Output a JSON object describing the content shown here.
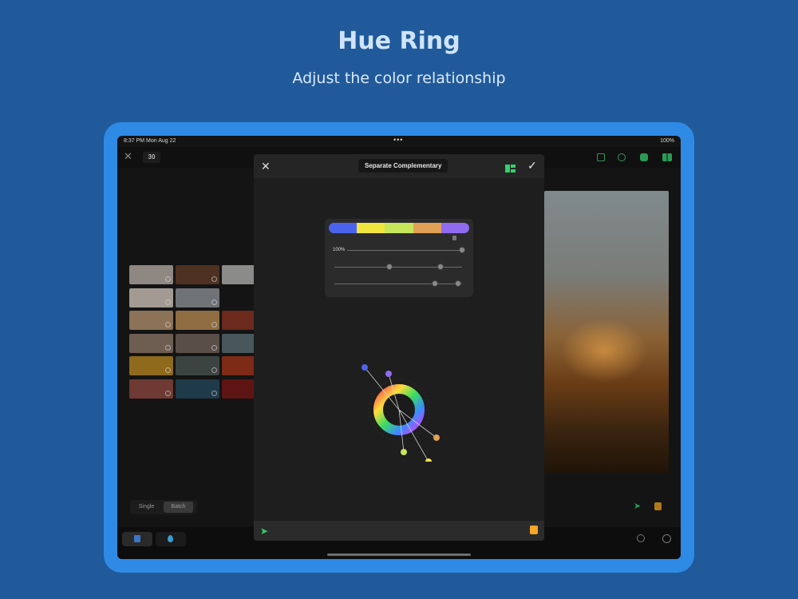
{
  "promo": {
    "title": "Hue Ring",
    "subtitle": "Adjust the color relationship"
  },
  "status_bar": {
    "time": "8:37 PM  Mon Aug 22",
    "center": "•••",
    "battery": "100%"
  },
  "toolbar": {
    "count": "30"
  },
  "bottom_toggle": {
    "single": "Single",
    "batch": "Batch",
    "active": "Batch"
  },
  "modal": {
    "title": "Separate Complementary",
    "palette": [
      "#4b63ec",
      "#f1e63d",
      "#c5e55a",
      "#e0a055",
      "#8f6bf0"
    ],
    "percent_label": "100%",
    "sliders": [
      {
        "values": [
          1.0
        ]
      },
      {
        "values": [
          0.43,
          0.83
        ]
      },
      {
        "values": [
          0.79,
          0.97
        ]
      }
    ]
  },
  "hue_ring": {
    "handles": [
      {
        "color": "#4b63ec"
      },
      {
        "color": "#8f6bf0"
      },
      {
        "color": "#f1e63d"
      },
      {
        "color": "#c5e55a"
      },
      {
        "color": "#e0a055"
      }
    ]
  },
  "swatch_colors": [
    [
      "#8f8781",
      "#4e3120",
      "#8b8b8a"
    ],
    [
      "#a39b93",
      "#6f7378",
      null
    ],
    [
      "#8c7256",
      "#8f6c42",
      "#6b2a1c"
    ],
    [
      "#6e5e52",
      "#5a4f48",
      "#47575c"
    ],
    [
      "#8f6a1c",
      "#3b4440",
      "#7d2a16"
    ],
    [
      "#6e3a33",
      "#1f3a49",
      "#5f1414"
    ]
  ],
  "accent": {
    "green": "#32d26a",
    "orange": "#f5a623"
  }
}
